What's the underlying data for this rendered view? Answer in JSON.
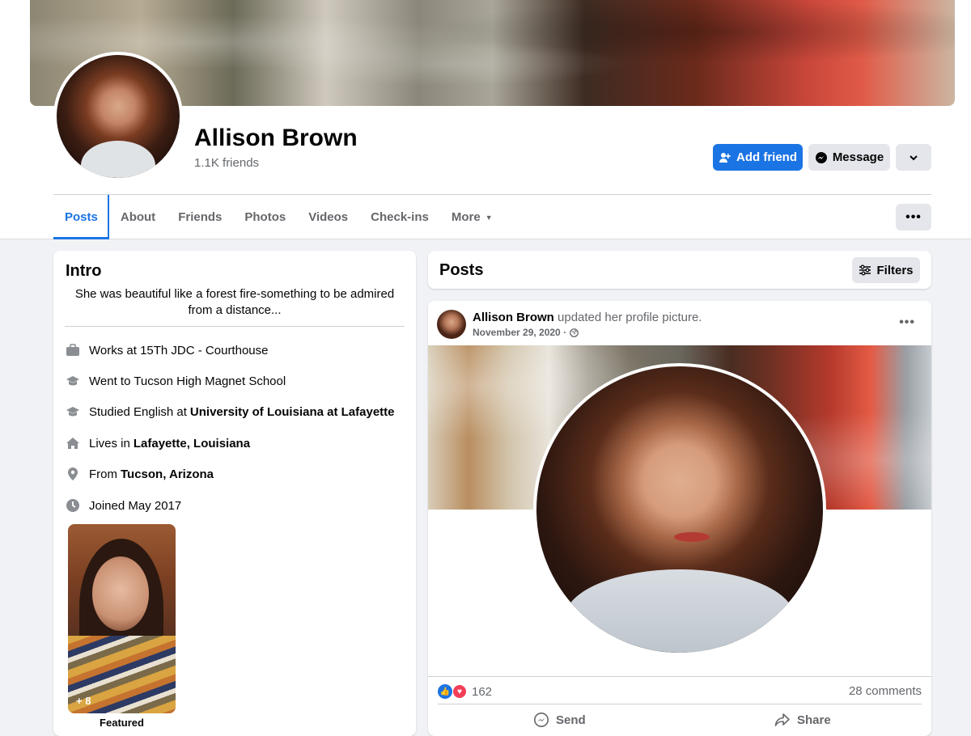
{
  "profile": {
    "name": "Allison Brown",
    "friends": "1.1K friends",
    "add_friend_label": "Add friend",
    "message_label": "Message"
  },
  "tabs": [
    {
      "label": "Posts",
      "active": true
    },
    {
      "label": "About"
    },
    {
      "label": "Friends"
    },
    {
      "label": "Photos"
    },
    {
      "label": "Videos"
    },
    {
      "label": "Check-ins"
    },
    {
      "label": "More"
    }
  ],
  "intro": {
    "title": "Intro",
    "bio": "She was beautiful like a forest fire-something to be admired from a distance...",
    "rows": [
      {
        "icon": "briefcase-icon",
        "text": "Works at 15Th JDC - Courthouse",
        "bold": ""
      },
      {
        "icon": "graduation-cap-icon",
        "text": "Went to Tucson High Magnet School",
        "bold": ""
      },
      {
        "icon": "graduation-cap-icon",
        "text": "Studied English at",
        "bold": "University of Louisiana at Lafayette"
      },
      {
        "icon": "home-icon",
        "text": "Lives in",
        "bold": "Lafayette, Louisiana"
      },
      {
        "icon": "location-pin-icon",
        "text": "From",
        "bold": "Tucson, Arizona"
      },
      {
        "icon": "clock-icon",
        "text": "Joined May 2017",
        "bold": ""
      }
    ],
    "featured_count": "+ 8",
    "featured_label": "Featured"
  },
  "posts_header": {
    "title": "Posts",
    "filters_label": "Filters"
  },
  "post": {
    "author": "Allison Brown",
    "action": "updated her profile picture.",
    "date": "November 29, 2020 ·",
    "reaction_count": "162",
    "comments": "28 comments",
    "send_label": "Send",
    "share_label": "Share"
  },
  "colors": {
    "accent": "#1b74e4",
    "secondary_text": "#65676b",
    "page_bg": "#f0f2f5"
  }
}
